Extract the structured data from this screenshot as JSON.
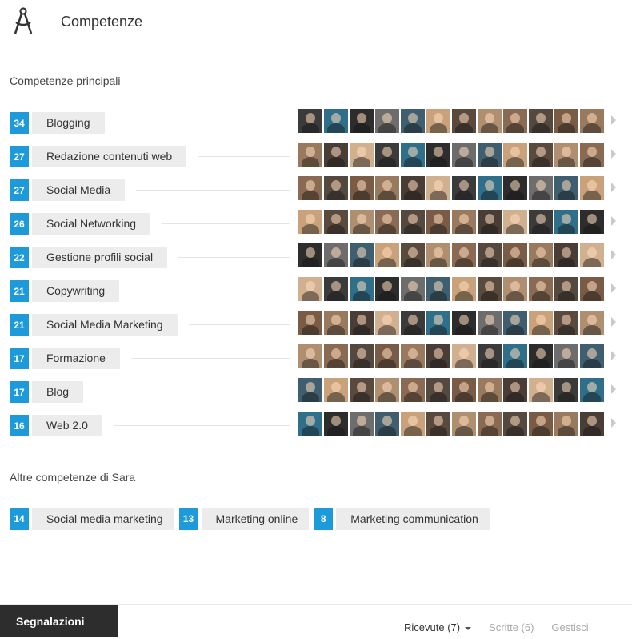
{
  "section": {
    "title": "Competenze",
    "icon": "compass-icon"
  },
  "top_skills_heading": "Competenze principali",
  "skills": [
    {
      "count": "34",
      "label": "Blogging"
    },
    {
      "count": "27",
      "label": "Redazione contenuti web"
    },
    {
      "count": "27",
      "label": "Social Media"
    },
    {
      "count": "26",
      "label": "Social Networking"
    },
    {
      "count": "22",
      "label": "Gestione profili social"
    },
    {
      "count": "21",
      "label": "Copywriting"
    },
    {
      "count": "21",
      "label": "Social Media Marketing"
    },
    {
      "count": "17",
      "label": "Formazione"
    },
    {
      "count": "17",
      "label": "Blog"
    },
    {
      "count": "16",
      "label": "Web 2.0"
    }
  ],
  "other_skills_heading": "Altre competenze di Sara",
  "other_skills": [
    {
      "count": "14",
      "label": "Social media marketing"
    },
    {
      "count": "13",
      "label": "Marketing online"
    },
    {
      "count": "8",
      "label": "Marketing communication"
    }
  ],
  "footer": {
    "section_tab": "Segnalazioni",
    "tabs": [
      {
        "label": "Ricevute (7)",
        "active": true
      },
      {
        "label": "Scritte (6)",
        "active": false
      },
      {
        "label": "Gestisci",
        "active": false
      }
    ]
  },
  "colors": {
    "badge": "#1c9ad9",
    "pill": "#ececec",
    "footer_tab": "#2d2d2d"
  }
}
